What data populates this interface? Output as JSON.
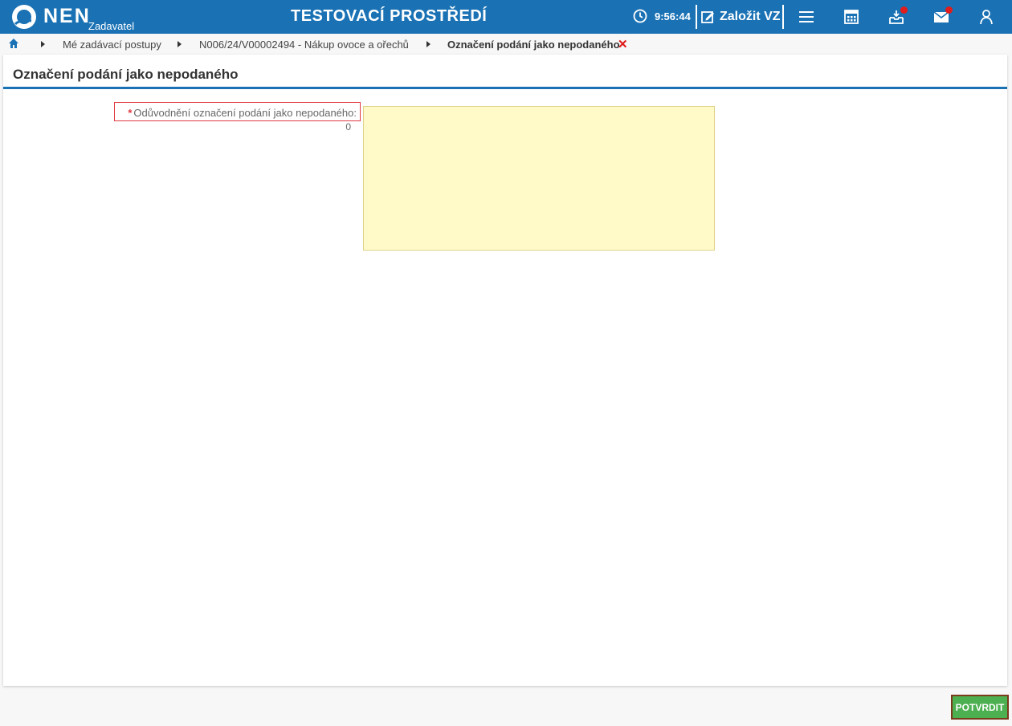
{
  "topbar": {
    "logo_text": "NEN",
    "logo_sub": "Zadavatel",
    "environment": "TESTOVACÍ PROSTŘEDÍ",
    "clock_time": "9:56:44",
    "new_vz_label": "Založit VZ",
    "icons": [
      "clock-icon",
      "edit-icon",
      "menu-icon",
      "calendar-icon",
      "inbox-icon",
      "mail-icon",
      "user-icon"
    ],
    "notification_color": "#e21b1b"
  },
  "breadcrumb": {
    "items": [
      "Mé zadávací postupy",
      "N006/24/V00002494 - Nákup ovoce a ořechů",
      "Označení podání jako nepodaného"
    ]
  },
  "panel": {
    "title": "Označení podání jako nepodaného",
    "field": {
      "required_mark": "*",
      "label": "Odůvodnění označení podání jako nepodaného:",
      "char_count": "0",
      "value": ""
    }
  },
  "footer": {
    "confirm_label": "POTVRDIT"
  },
  "colors": {
    "primary": "#1a72b5",
    "textarea_bg": "#fffac8",
    "confirm_bg": "#4caf50",
    "required": "#e0393e"
  }
}
